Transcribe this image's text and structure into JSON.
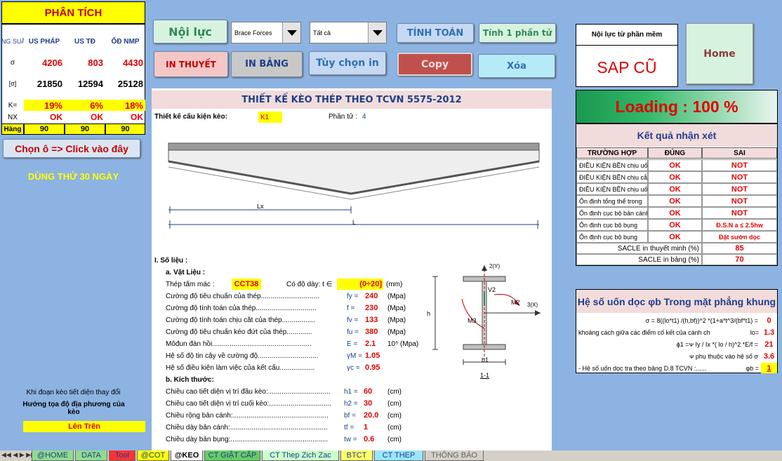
{
  "left_panel": {
    "title": "PHÂN TÍCH",
    "headers": [
      "ỨNG SUẤT",
      "US PHÁP",
      "US TĐ",
      "ỔĐ NMP"
    ],
    "row_labels": [
      "σ",
      "[σ]",
      "K=",
      "NX",
      "Hàng"
    ],
    "sigma": [
      "4206",
      "803",
      "4430"
    ],
    "allow": [
      "21850",
      "12594",
      "25128"
    ],
    "k": [
      "19%",
      "6%",
      "18%"
    ],
    "nx": [
      "OK",
      "OK",
      "OK"
    ],
    "hang": [
      "90",
      "90",
      "90"
    ],
    "choose_btn": "Chọn ô => Click vào đây",
    "trial": "DÙNG THỬ 30 NGÀY",
    "note1": "Khi đoạn kèo tiết diện thay đổi",
    "note2": "Hướng tọa độ địa phương của kèo",
    "position_btn": "Lên Trên"
  },
  "toolbar": {
    "noi_luc": "Nội lực",
    "select1": "Brace Forces",
    "select2": "Tất cả",
    "tinh_toan": "TÍNH TOÁN",
    "tinh1": "Tính 1 phần tử",
    "in_thuyet": "IN THUYẾT",
    "in_bang": "IN BẢNG",
    "tuy_chon": "Tùy chọn in",
    "copy": "Copy",
    "xoa": "Xóa",
    "home": "Home"
  },
  "sap": {
    "label": "Nội lực từ phần mềm",
    "value": "SAP CŨ"
  },
  "loading": "Loading : 100 %",
  "results": {
    "title": "Kết quả nhận xét",
    "headers": [
      "TRƯỜNG HỢP",
      "ĐÚNG",
      "SAI"
    ],
    "rows": [
      {
        "name": "ĐIỀU KIỆN BỀN chịu uốn",
        "ok": "OK",
        "bad": "NOT"
      },
      {
        "name": "ĐIỀU KIỆN BỀN chịu cắt",
        "ok": "OK",
        "bad": "NOT"
      },
      {
        "name": "ĐIỀU KIỆN BỀN chịu uốn cắt",
        "ok": "OK",
        "bad": "NOT"
      },
      {
        "name": "Ổn định tổng thể trong",
        "ok": "OK",
        "bad": "NOT"
      },
      {
        "name": "Ổn định cục bộ bản cánh",
        "ok": "OK",
        "bad": "NOT"
      },
      {
        "name": "Ổn định cục bộ bụng",
        "ok": "OK",
        "bad": "Đ.S.N a ≤ 2.5hw"
      },
      {
        "name": "Ổn định cục bộ bụng",
        "ok": "OK",
        "bad": "Đặt sườn dọc"
      }
    ],
    "scale1_label": "SACLE in thuyết minh (%)",
    "scale1": "85",
    "scale2_label": "SACLE in bảng (%)",
    "scale2": "70"
  },
  "buckling": {
    "title": "Hệ số uốn dọc φb Trong mặt phẳng khung",
    "rows": [
      {
        "label": "σ = 8((lo*t1) /(h,bf))^2 *(1+a*t^3/(bf*t1) =",
        "value": "0"
      },
      {
        "label": "khoảng cách giữa các điểm cố kết của cánh ch",
        "sym": "lo=",
        "value": "1.3"
      },
      {
        "label": "ϕ1 =ᴪ Iy / Ix *( lo / h)^2 *E/f =",
        "value": "21"
      },
      {
        "label": "ᴪ phụ thuộc vào hệ số σ",
        "value": "3.6"
      },
      {
        "label": "- Hệ số uốn dọc tra theo bảng D.8 TCVN :......",
        "sym": "φb =",
        "value": "1"
      }
    ]
  },
  "doc": {
    "title": "THIẾT KẾ KÈO THÉP THEO TCVN 5575-2012",
    "design_label": "Thiết kế cấu kiện kèo:",
    "design_value": "K1",
    "element_label": "Phần tử :",
    "element_value": "4",
    "lx": "Lx",
    "l": "L",
    "section_head": "I.  Số liệu :",
    "material_head": "a. Vật Liệu :",
    "steel_label": "Thép tấm mác :",
    "steel_value": "CCT38",
    "thick_label": "Có độ dày:  t ∈",
    "thick_value": "(0÷20]",
    "thick_unit": "(mm)",
    "props": [
      {
        "label": "Cường độ tiêu chuẩn của thép..............................",
        "sym": "fy =",
        "value": "240",
        "unit": "(Mpa)"
      },
      {
        "label": "Cường độ tính toán của thép...............................",
        "sym": "f =",
        "value": "230",
        "unit": "(Mpa)"
      },
      {
        "label": "Cường độ tính toán chịu cắt của thép.................",
        "sym": "fv =",
        "value": "133",
        "unit": "(Mpa)"
      },
      {
        "label": "Cường độ tiêu chuẩn kéo đứt của thép.............",
        "sym": "fu =",
        "value": "380",
        "unit": "(Mpa)"
      },
      {
        "label": "Môđun đàn hồi...................................................",
        "sym": "E =",
        "value": "2.1",
        "unit": "10⁵ (Mpa)"
      },
      {
        "label": "Hệ số độ tin cậy về cường độ...............................",
        "sym": "γM =",
        "value": "1.05",
        "unit": ""
      },
      {
        "label": "Hệ số điều kiện làm việc của kết cấu..................",
        "sym": "γc =",
        "value": "0.95",
        "unit": ""
      }
    ],
    "dims_head": "b. Kích thước:",
    "dims": [
      {
        "label": "Chiều cao tiết diện vị trí đầu kèo:................................",
        "sym": "h1 =",
        "value": "60",
        "unit": "(cm)"
      },
      {
        "label": "Chiều cao tiết diện vị trí cuối kèo:................................",
        "sym": "h2 =",
        "value": "30",
        "unit": "(cm)"
      },
      {
        "label": "Chiều rộng bản cánh:.................................................",
        "sym": "bf =",
        "value": "20.0",
        "unit": "(cm)"
      },
      {
        "label": "Chiều dày bản cánh:..................................................",
        "sym": "tf =",
        "value": "1",
        "unit": "(cm)"
      },
      {
        "label": "Chiều dày bản bụng:..................................................",
        "sym": "tw =",
        "value": "0.6",
        "unit": "(cm)"
      }
    ],
    "diagram": {
      "axis2": "2(Y)",
      "axis3": "3(X)",
      "v2": "V2",
      "m2": "M2",
      "m3": "M3",
      "h": "h",
      "b1": "b1",
      "cut": "1-1"
    }
  },
  "tabs": [
    "@HOME",
    "DATA",
    "Tool",
    "@COT",
    "@KEO",
    "CT GIẬT CẤP",
    "CT Thep Zich Zac",
    "BTCT",
    "CT THEP",
    "THÔNG BÁO"
  ]
}
